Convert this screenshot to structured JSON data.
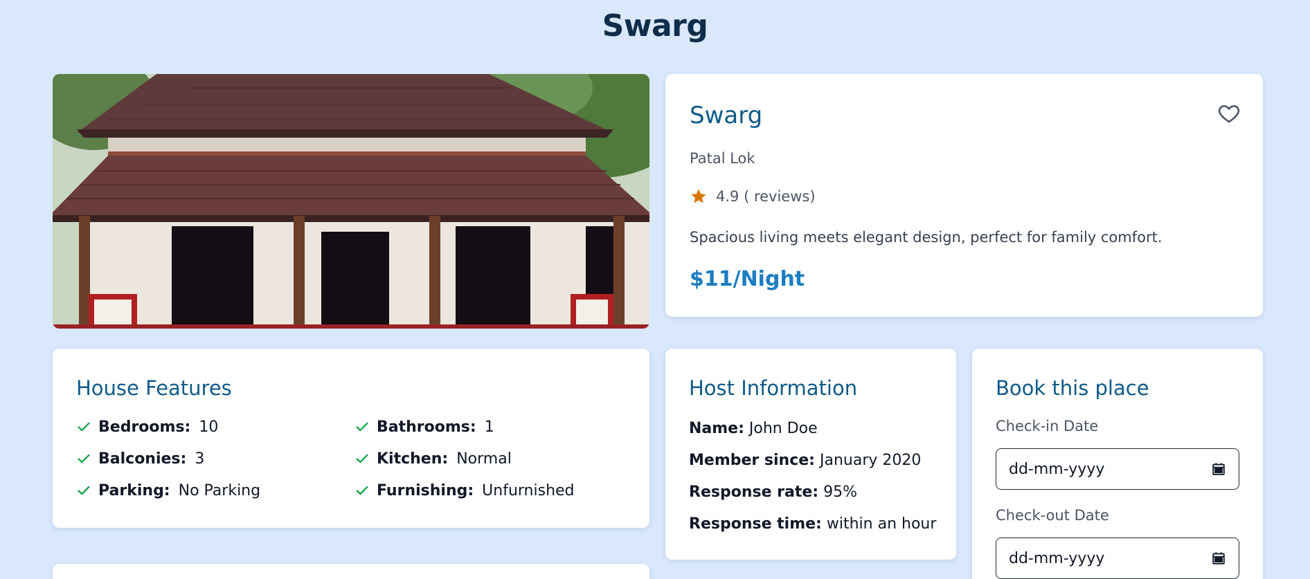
{
  "page": {
    "title": "Swarg"
  },
  "listing": {
    "name": "Swarg",
    "location": "Patal Lok",
    "rating_text": "4.9 ( reviews)",
    "description": "Spacious living meets elegant design, perfect for family comfort.",
    "price": "$11/Night"
  },
  "features": {
    "title": "House Features",
    "items": [
      {
        "label": "Bedrooms:",
        "value": "10"
      },
      {
        "label": "Bathrooms:",
        "value": "1"
      },
      {
        "label": "Balconies:",
        "value": "3"
      },
      {
        "label": "Kitchen:",
        "value": "Normal"
      },
      {
        "label": "Parking:",
        "value": "No Parking"
      },
      {
        "label": "Furnishing:",
        "value": "Unfurnished"
      }
    ]
  },
  "host": {
    "title": "Host Information",
    "rows": [
      {
        "label": "Name:",
        "value": "John Doe"
      },
      {
        "label": "Member since:",
        "value": "January 2020"
      },
      {
        "label": "Response rate:",
        "value": "95%"
      },
      {
        "label": "Response time:",
        "value": "within an hour"
      }
    ]
  },
  "booking": {
    "title": "Book this place",
    "checkin_label": "Check-in Date",
    "checkin_placeholder": "dd-mm-yyyy",
    "checkout_label": "Check-out Date",
    "checkout_placeholder": "dd-mm-yyyy"
  },
  "icons": {
    "heart": "heart-icon",
    "star": "star-icon",
    "check": "check-icon",
    "calendar": "calendar-icon"
  },
  "colors": {
    "background": "#d9e8fc",
    "accent": "#0e5a8a",
    "price": "#1b7dc2",
    "check": "#16a34a",
    "star": "#d97706"
  }
}
